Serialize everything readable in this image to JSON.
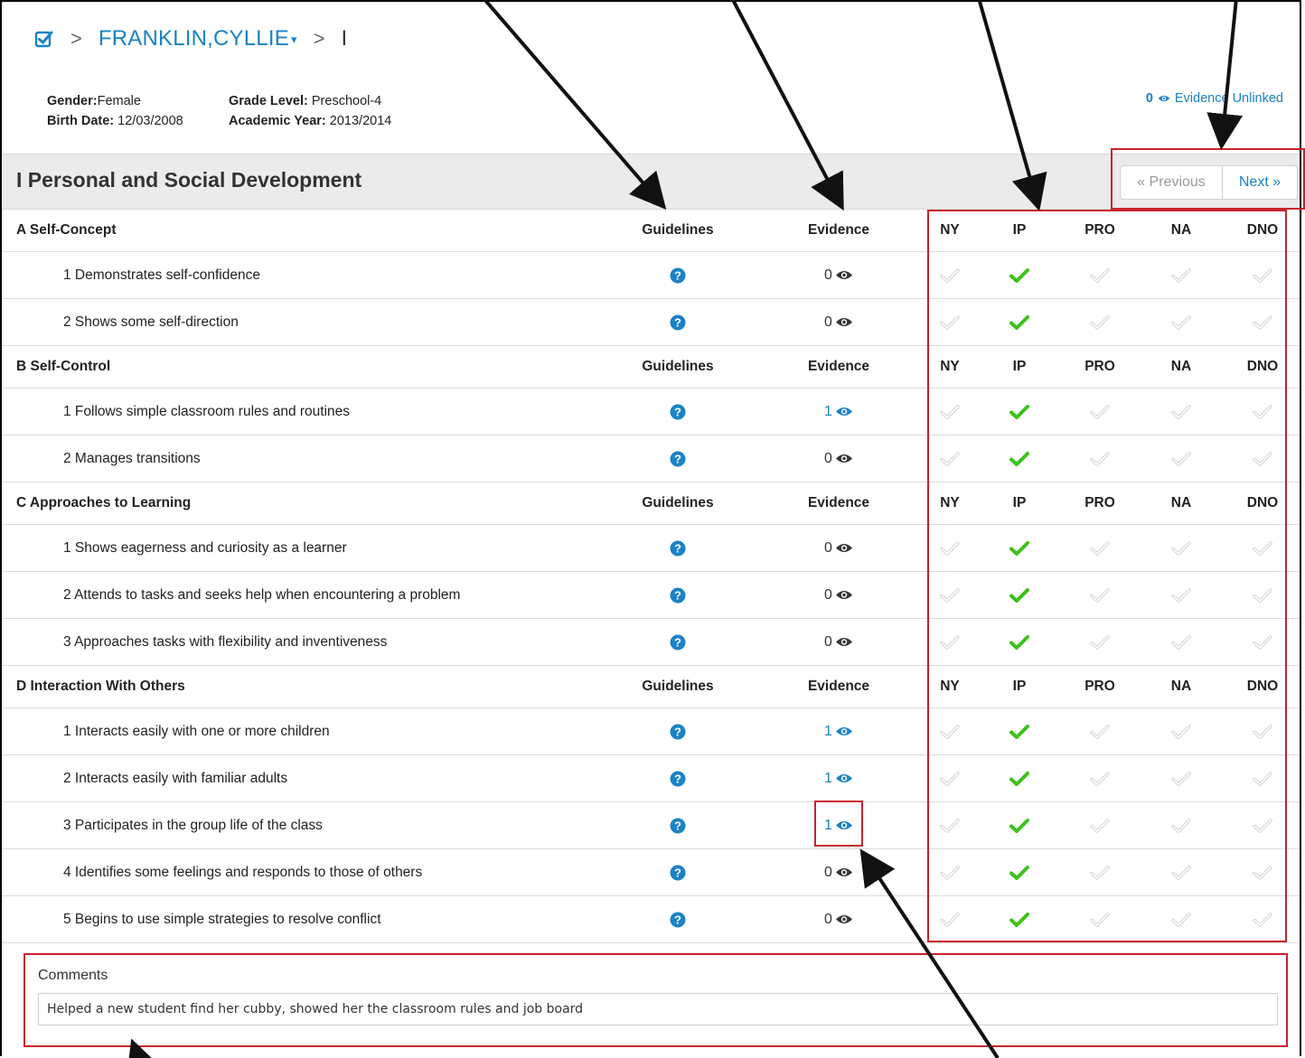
{
  "breadcrumb": {
    "separator": ">",
    "student": "FRANKLIN,CYLLIE",
    "caret": "▾",
    "section": "I"
  },
  "student_info": {
    "gender_label": "Gender:",
    "gender": "Female",
    "birth_label": "Birth Date:",
    "birth_date": "12/03/2008",
    "grade_label": "Grade Level:",
    "grade": "Preschool-4",
    "year_label": "Academic Year:",
    "year": "2013/2014"
  },
  "evidence_unlinked": {
    "count": "0",
    "label": "Evidence Unlinked"
  },
  "section_title": "I Personal and Social Development",
  "pager": {
    "previous": "« Previous",
    "next": "Next »"
  },
  "column_headers": {
    "guidelines": "Guidelines",
    "evidence": "Evidence",
    "ratings": [
      "NY",
      "IP",
      "PRO",
      "NA",
      "DNO"
    ]
  },
  "groups": [
    {
      "title": "A Self-Concept",
      "items": [
        {
          "label": "1 Demonstrates self-confidence",
          "evidence": "0",
          "rating": "IP"
        },
        {
          "label": "2 Shows some self-direction",
          "evidence": "0",
          "rating": "IP"
        }
      ]
    },
    {
      "title": "B Self-Control",
      "items": [
        {
          "label": "1 Follows simple classroom rules and routines",
          "evidence": "1",
          "rating": "IP"
        },
        {
          "label": "2 Manages transitions",
          "evidence": "0",
          "rating": "IP"
        }
      ]
    },
    {
      "title": "C Approaches to Learning",
      "items": [
        {
          "label": "1 Shows eagerness and curiosity as a learner",
          "evidence": "0",
          "rating": "IP"
        },
        {
          "label": "2 Attends to tasks and seeks help when encountering a problem",
          "evidence": "0",
          "rating": "IP"
        },
        {
          "label": "3 Approaches tasks with flexibility and inventiveness",
          "evidence": "0",
          "rating": "IP"
        }
      ]
    },
    {
      "title": "D Interaction With Others",
      "items": [
        {
          "label": "1 Interacts easily with one or more children",
          "evidence": "1",
          "rating": "IP"
        },
        {
          "label": "2 Interacts easily with familiar adults",
          "evidence": "1",
          "rating": "IP"
        },
        {
          "label": "3 Participates in the group life of the class",
          "evidence": "1",
          "rating": "IP"
        },
        {
          "label": "4 Identifies some feelings and responds to those of others",
          "evidence": "0",
          "rating": "IP"
        },
        {
          "label": "5 Begins to use simple strategies to resolve conflict",
          "evidence": "0",
          "rating": "IP"
        }
      ]
    }
  ],
  "comments": {
    "label": "Comments",
    "value": "Helped a new student find her cubby, showed her the classroom rules and job board"
  },
  "colors": {
    "link": "#1a82c6",
    "selected_check": "#3cc21a",
    "unselected_check": "#cfcfcf",
    "highlight_box": "#c8232c"
  }
}
